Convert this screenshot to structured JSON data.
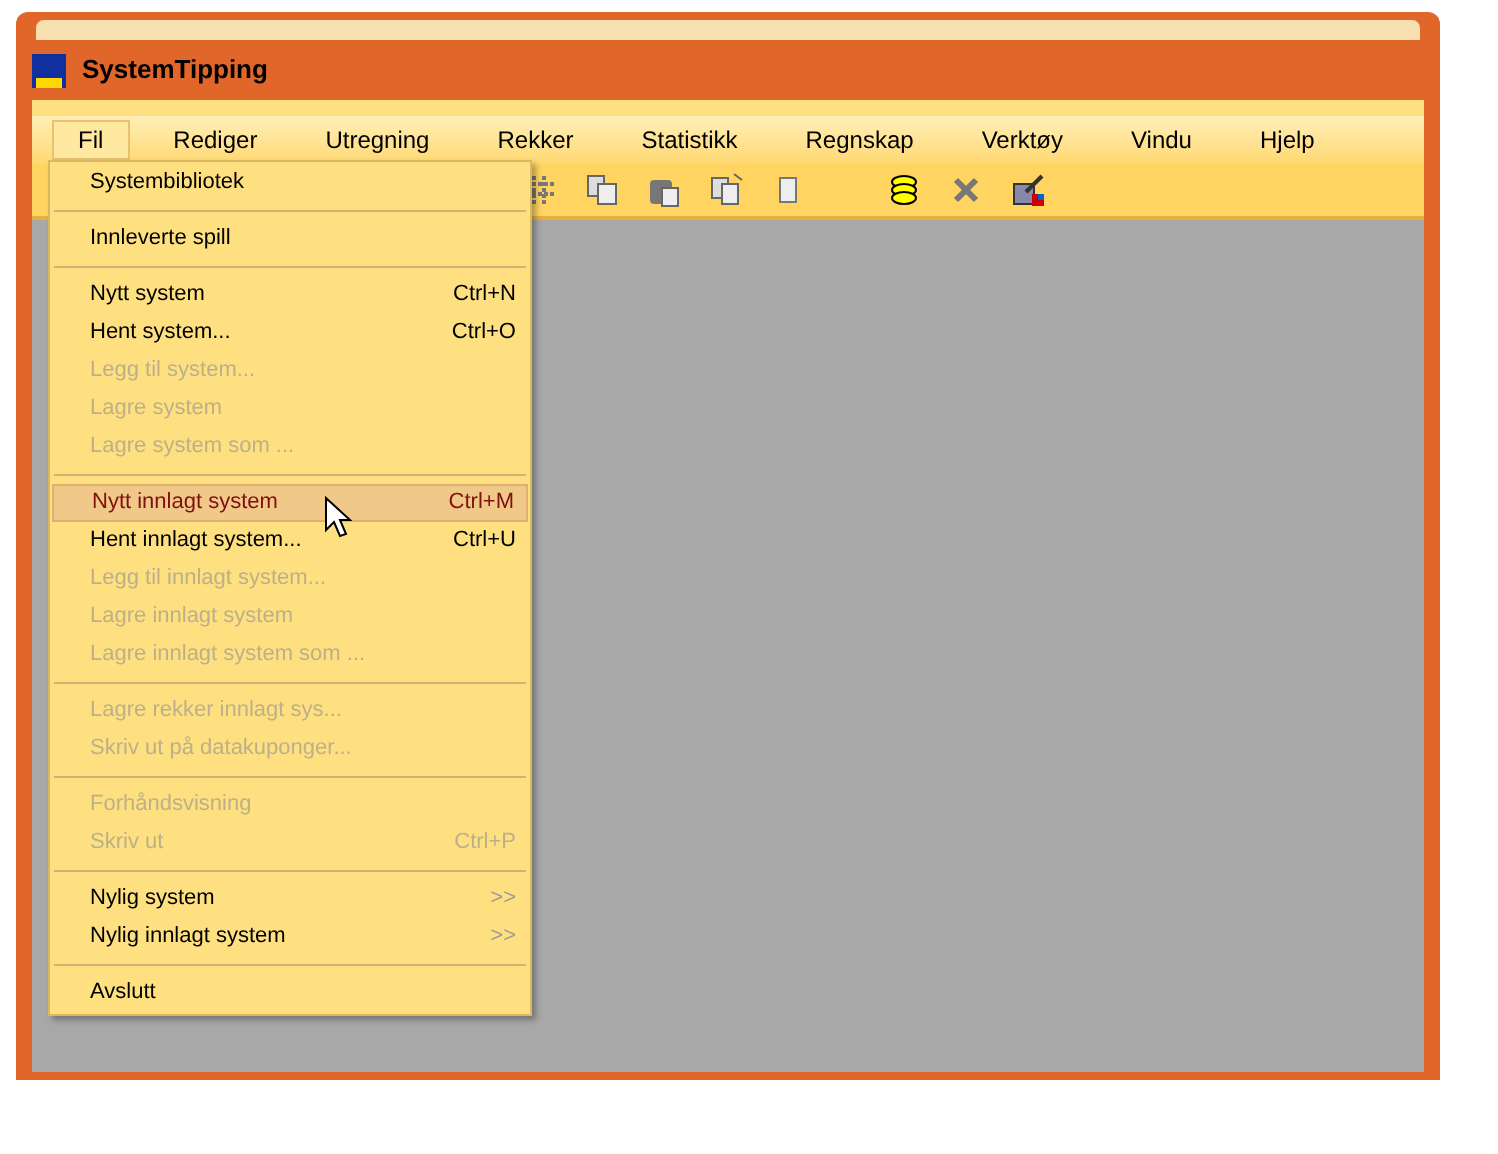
{
  "window": {
    "title": "SystemTipping"
  },
  "menu_bar": [
    {
      "label": "Fil",
      "selected": true
    },
    {
      "label": "Rediger",
      "selected": false
    },
    {
      "label": "Utregning",
      "selected": false
    },
    {
      "label": "Rekker",
      "selected": false
    },
    {
      "label": "Statistikk",
      "selected": false
    },
    {
      "label": "Regnskap",
      "selected": false
    },
    {
      "label": "Verktøy",
      "selected": false
    },
    {
      "label": "Vindu",
      "selected": false
    },
    {
      "label": "Hjelp",
      "selected": false
    }
  ],
  "file_menu": [
    {
      "kind": "item",
      "label": "Systembibliotek",
      "disabled": false,
      "selected": false
    },
    {
      "kind": "separator"
    },
    {
      "kind": "item",
      "label": "Innleverte spill",
      "disabled": false,
      "selected": false
    },
    {
      "kind": "separator"
    },
    {
      "kind": "item",
      "label": "Nytt system",
      "shortcut": "Ctrl+N",
      "disabled": false,
      "selected": false
    },
    {
      "kind": "item",
      "label": "Hent system...",
      "shortcut": "Ctrl+O",
      "disabled": false,
      "selected": false
    },
    {
      "kind": "item",
      "label": "Legg til system...",
      "disabled": true,
      "selected": false
    },
    {
      "kind": "item",
      "label": "Lagre system",
      "disabled": true,
      "selected": false
    },
    {
      "kind": "item",
      "label": "Lagre system som ...",
      "disabled": true,
      "selected": false
    },
    {
      "kind": "separator"
    },
    {
      "kind": "item",
      "label": "Nytt innlagt system",
      "shortcut": "Ctrl+M",
      "disabled": false,
      "selected": true
    },
    {
      "kind": "item",
      "label": "Hent innlagt system...",
      "shortcut": "Ctrl+U",
      "disabled": false,
      "selected": false
    },
    {
      "kind": "item",
      "label": "Legg til innlagt system...",
      "disabled": true,
      "selected": false
    },
    {
      "kind": "item",
      "label": "Lagre innlagt system",
      "disabled": true,
      "selected": false
    },
    {
      "kind": "item",
      "label": "Lagre innlagt system som ...",
      "disabled": true,
      "selected": false
    },
    {
      "kind": "separator"
    },
    {
      "kind": "item",
      "label": "Lagre rekker innlagt sys...",
      "disabled": true,
      "selected": false
    },
    {
      "kind": "item",
      "label": "Skriv ut på datakuponger...",
      "disabled": true,
      "selected": false
    },
    {
      "kind": "separator"
    },
    {
      "kind": "item",
      "label": "Forhåndsvisning",
      "disabled": true,
      "selected": false
    },
    {
      "kind": "item",
      "label": "Skriv ut",
      "shortcut": "Ctrl+P",
      "disabled": true,
      "selected": false
    },
    {
      "kind": "separator"
    },
    {
      "kind": "item",
      "label": "Nylig system",
      "submenu": ">>",
      "disabled": false,
      "selected": false
    },
    {
      "kind": "item",
      "label": "Nylig innlagt system",
      "submenu": ">>",
      "disabled": false,
      "selected": false
    },
    {
      "kind": "separator"
    },
    {
      "kind": "item",
      "label": "Avslutt",
      "disabled": false,
      "selected": false
    }
  ]
}
